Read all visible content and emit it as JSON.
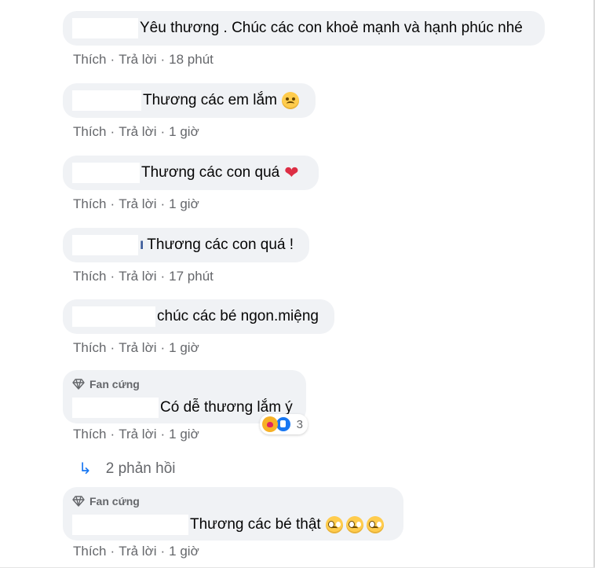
{
  "meta_actions": {
    "like": "Thích",
    "reply": "Trả lời",
    "separator": "·"
  },
  "comments": [
    {
      "text": "Yêu thương . Chúc các con khoẻ mạnh và hạnh phúc nhé",
      "time": "18 phút"
    },
    {
      "text": "Thương các em lắm",
      "time": "1 giờ",
      "emoji": "crying-face-icon"
    },
    {
      "text": "Thương các con quá",
      "time": "1 giờ",
      "emoji": "red-heart-icon"
    },
    {
      "text": "Thương các con quá !",
      "time": "17 phút",
      "prefix": "ı"
    },
    {
      "text": "chúc các bé ngon.miệng",
      "time": "1 giờ"
    },
    {
      "badge": "Fan cứng",
      "text": "Có dễ thương lắm ý",
      "time": "1 giờ",
      "reaction_count": "3",
      "reactions": [
        "care-reaction-icon",
        "like-reaction-icon"
      ]
    },
    {
      "badge": "Fan cứng",
      "text": "Thương các bé thật",
      "time": "1 giờ",
      "emoji": "pleading-face-icon"
    }
  ],
  "replies_link": "2 phản hồi",
  "colors": {
    "bubble": "#f0f2f5",
    "meta": "#65676b",
    "link": "#1877f2"
  }
}
